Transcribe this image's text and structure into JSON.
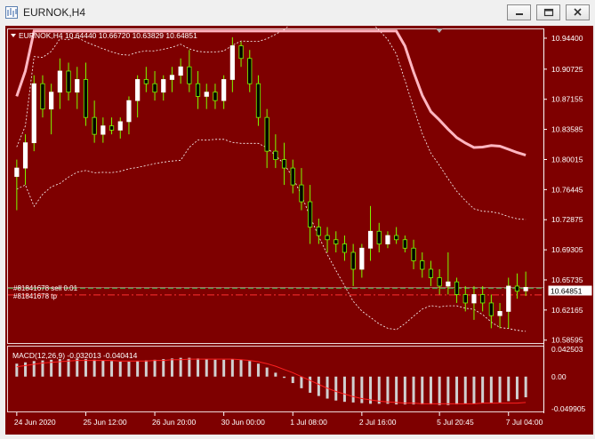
{
  "window": {
    "title": "EURNOK,H4"
  },
  "chart_info": {
    "header": "EURNOK,H4  10.64440 10.66720 10.63829 10.64851"
  },
  "price_axis": {
    "labels": [
      "10.94400",
      "10.90725",
      "10.87155",
      "10.83585",
      "10.80015",
      "10.76445",
      "10.72875",
      "10.69305",
      "10.65735",
      "10.62165",
      "10.58595"
    ],
    "current_price": "10.64851"
  },
  "order_lines": {
    "sell_label": "#81841678 sell 0.01",
    "tp_label": "#81841678 tp"
  },
  "macd": {
    "header": "MACD(12,26,9) -0.032013 -0.040414",
    "axis_labels": [
      "0.042503",
      "0.00",
      "-0.049905"
    ]
  },
  "time_axis": {
    "labels": [
      "24 Jun 2020",
      "25 Jun 12:00",
      "26 Jun 20:00",
      "30 Jun 00:00",
      "1 Jul 08:00",
      "2 Jul 16:00",
      "5 Jul 20:45",
      "7 Jul 04:00"
    ]
  },
  "colors": {
    "background": "#7e0000",
    "bull_candle": "#ffffff",
    "bear_candle": "#7cfc00",
    "bollinger_outer": "#ffb6c1",
    "macd_signal": "#ff2020"
  },
  "chart_data": {
    "type": "candlestick",
    "symbol": "EURNOK",
    "timeframe": "H4",
    "ohlc_last": {
      "open": 10.6444,
      "high": 10.6672,
      "low": 10.63829,
      "close": 10.64851
    },
    "ylim": [
      10.5825,
      10.9545
    ],
    "candles": [
      [
        10.78,
        10.8,
        10.74,
        10.79
      ],
      [
        10.79,
        10.83,
        10.77,
        10.82
      ],
      [
        10.82,
        10.9,
        10.81,
        10.89
      ],
      [
        10.89,
        10.9,
        10.85,
        10.86
      ],
      [
        10.86,
        10.89,
        10.83,
        10.88
      ],
      [
        10.88,
        10.92,
        10.86,
        10.905
      ],
      [
        10.905,
        10.915,
        10.87,
        10.88
      ],
      [
        10.88,
        10.91,
        10.86,
        10.895
      ],
      [
        10.895,
        10.915,
        10.84,
        10.85
      ],
      [
        10.85,
        10.87,
        10.82,
        10.83
      ],
      [
        10.83,
        10.85,
        10.82,
        10.84
      ],
      [
        10.84,
        10.85,
        10.83,
        10.835
      ],
      [
        10.835,
        10.85,
        10.825,
        10.845
      ],
      [
        10.845,
        10.875,
        10.83,
        10.87
      ],
      [
        10.87,
        10.9,
        10.85,
        10.895
      ],
      [
        10.895,
        10.91,
        10.88,
        10.89
      ],
      [
        10.89,
        10.905,
        10.87,
        10.88
      ],
      [
        10.88,
        10.9,
        10.87,
        10.895
      ],
      [
        10.895,
        10.91,
        10.88,
        10.9
      ],
      [
        10.9,
        10.92,
        10.89,
        10.91
      ],
      [
        10.91,
        10.93,
        10.88,
        10.89
      ],
      [
        10.89,
        10.905,
        10.86,
        10.875
      ],
      [
        10.875,
        10.89,
        10.86,
        10.88
      ],
      [
        10.88,
        10.89,
        10.86,
        10.87
      ],
      [
        10.87,
        10.9,
        10.86,
        10.895
      ],
      [
        10.895,
        10.945,
        10.88,
        10.935
      ],
      [
        10.935,
        10.94,
        10.91,
        10.92
      ],
      [
        10.92,
        10.93,
        10.88,
        10.89
      ],
      [
        10.89,
        10.9,
        10.84,
        10.85
      ],
      [
        10.85,
        10.86,
        10.79,
        10.81
      ],
      [
        10.81,
        10.83,
        10.79,
        10.8
      ],
      [
        10.8,
        10.82,
        10.77,
        10.79
      ],
      [
        10.79,
        10.8,
        10.76,
        10.77
      ],
      [
        10.77,
        10.79,
        10.74,
        10.75
      ],
      [
        10.75,
        10.77,
        10.7,
        10.72
      ],
      [
        10.72,
        10.73,
        10.7,
        10.71
      ],
      [
        10.71,
        10.72,
        10.69,
        10.705
      ],
      [
        10.705,
        10.715,
        10.69,
        10.7
      ],
      [
        10.7,
        10.71,
        10.68,
        10.69
      ],
      [
        10.69,
        10.7,
        10.65,
        10.67
      ],
      [
        10.67,
        10.7,
        10.66,
        10.695
      ],
      [
        10.695,
        10.745,
        10.68,
        10.715
      ],
      [
        10.715,
        10.725,
        10.69,
        10.7
      ],
      [
        10.7,
        10.715,
        10.695,
        10.71
      ],
      [
        10.71,
        10.72,
        10.7,
        10.705
      ],
      [
        10.705,
        10.71,
        10.69,
        10.695
      ],
      [
        10.695,
        10.705,
        10.67,
        10.68
      ],
      [
        10.68,
        10.69,
        10.66,
        10.67
      ],
      [
        10.67,
        10.68,
        10.65,
        10.66
      ],
      [
        10.66,
        10.67,
        10.64,
        10.65
      ],
      [
        10.65,
        10.69,
        10.64,
        10.655
      ],
      [
        10.655,
        10.66,
        10.63,
        10.64
      ],
      [
        10.64,
        10.65,
        10.62,
        10.63
      ],
      [
        10.63,
        10.65,
        10.61,
        10.64
      ],
      [
        10.64,
        10.65,
        10.62,
        10.63
      ],
      [
        10.63,
        10.64,
        10.6,
        10.615
      ],
      [
        10.615,
        10.63,
        10.6,
        10.62
      ],
      [
        10.62,
        10.66,
        10.6,
        10.65
      ],
      [
        10.65,
        10.665,
        10.635,
        10.644
      ],
      [
        10.6444,
        10.6672,
        10.63829,
        10.64851
      ]
    ],
    "macd_histogram": [
      0.02,
      0.022,
      0.024,
      0.025,
      0.026,
      0.027,
      0.027,
      0.028,
      0.027,
      0.026,
      0.025,
      0.024,
      0.023,
      0.023,
      0.024,
      0.025,
      0.026,
      0.027,
      0.028,
      0.029,
      0.029,
      0.028,
      0.027,
      0.026,
      0.026,
      0.027,
      0.026,
      0.024,
      0.02,
      0.014,
      0.006,
      -0.002,
      -0.01,
      -0.018,
      -0.025,
      -0.03,
      -0.034,
      -0.037,
      -0.039,
      -0.04,
      -0.041,
      -0.042,
      -0.042,
      -0.042,
      -0.043,
      -0.043,
      -0.043,
      -0.043,
      -0.043,
      -0.044,
      -0.044,
      -0.043,
      -0.042,
      -0.042,
      -0.041,
      -0.041,
      -0.04,
      -0.038,
      -0.035,
      -0.032
    ],
    "macd_signal": [
      0.015,
      0.017,
      0.019,
      0.021,
      0.022,
      0.023,
      0.024,
      0.025,
      0.025,
      0.025,
      0.025,
      0.025,
      0.024,
      0.024,
      0.024,
      0.024,
      0.025,
      0.025,
      0.026,
      0.026,
      0.027,
      0.027,
      0.027,
      0.027,
      0.027,
      0.027,
      0.026,
      0.025,
      0.023,
      0.02,
      0.016,
      0.011,
      0.006,
      0.0,
      -0.006,
      -0.012,
      -0.018,
      -0.023,
      -0.027,
      -0.031,
      -0.034,
      -0.036,
      -0.038,
      -0.039,
      -0.04,
      -0.041,
      -0.041,
      -0.042,
      -0.042,
      -0.042,
      -0.042,
      -0.042,
      -0.042,
      -0.042,
      -0.041,
      -0.041,
      -0.041,
      -0.041,
      -0.041,
      -0.04
    ],
    "macd_ylim": [
      -0.0525,
      0.045
    ],
    "order_sell_price": 10.6475,
    "order_tp_price": 10.6395
  }
}
